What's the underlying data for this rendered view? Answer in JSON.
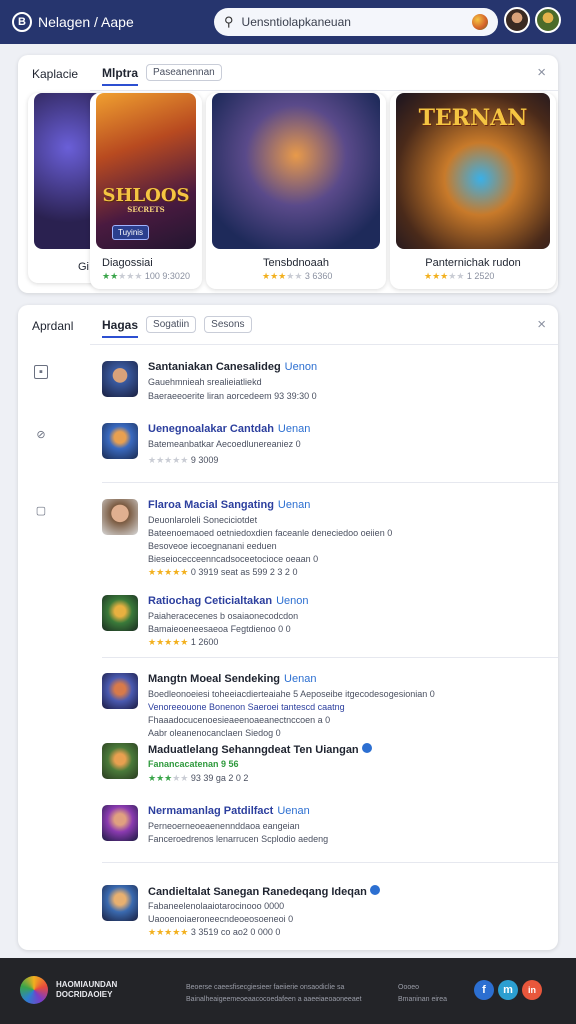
{
  "header": {
    "brand_icon": "B",
    "breadcrumb": "Nelagen / Aape",
    "search_value": "Uensntiolapkaneuan"
  },
  "panel1": {
    "side_title": "Kaplacie",
    "tab": "Mlptra",
    "chip": "Paseanennan",
    "close": "×",
    "cards": [
      {
        "art_title": "SHLOOS",
        "art_sub": "SECRETS",
        "button": "Tuyinis",
        "name": "Diagossiai",
        "partial_left": "Gi",
        "stars": [
          1,
          1,
          0,
          0,
          0
        ],
        "rating_text": "100 9:3020"
      },
      {
        "name": "Tensbdnoaah",
        "stars": [
          1,
          1,
          1,
          0,
          0
        ],
        "rating_text": "3 6360"
      },
      {
        "art_title": "TERNAN",
        "name": "Panternichak rudon",
        "stars": [
          1,
          1,
          1,
          0,
          0
        ],
        "rating_text": "1 2520"
      }
    ]
  },
  "panel2": {
    "side_title": "Aprdanl",
    "tab": "Hagas",
    "chip1": "Sogatiin",
    "chip2": "Sesons",
    "close": "×",
    "rows": [
      {
        "title": "Santaniakan Canesalideg",
        "tag": "Uenon",
        "lines": [
          "Gauehmnieah srealieiatliekd",
          "Baeraeeoerite liran aorcedeem 93 39:30 0"
        ]
      },
      {
        "title": "Uenegnoalakar Cantdah",
        "tag": "Uenan",
        "lines": [
          "Batemeanbatkar Aecoedlunereaniez 0"
        ],
        "rating_text": "9 3009"
      },
      {
        "title": "Flaroa Macial Sangating",
        "tag": "Uenan",
        "lines": [
          "Deuonlaroleli Soneciciotdet",
          "Bateenoemaoed oetniedoxdien faceanle deneciedoo oeiien 0",
          "Besoveoe iecoegnanani eeduen",
          "Bieseiocecceenncadsoceetocioce oeaan 0"
        ],
        "rating_text": "0 3919 seat as 599 2 3 2 0"
      },
      {
        "title": "Ratiochag Ceticialtakan",
        "tag": "Uenon",
        "lines": [
          "Paiaheracecenes b osaiaonecodcdon",
          "Bamaieoeneesaeoa Fegtdienoo 0 0"
        ],
        "rating_text": "1 2600"
      },
      {
        "title": "Mangtn Moeal Sendeking",
        "tag": "Uenan",
        "lines": [
          "Boedleonoeiesi toheeiacdierteaiahe 5 Aeposeibe itgecodesogesionian 0",
          "Venoreeouone Bonenon Saeroei tantescd caatng",
          "Fhaaadocucenoesieaeenoaeanectnccoen a 0",
          "Aabr oleanenocanclaen Siedog 0"
        ]
      },
      {
        "title": "Maduatlelang Sehanngdeat Ten Uiangan",
        "tag": "",
        "lines": [
          "Fanancacatenan 9 56"
        ],
        "green_line": true,
        "rating_text": "93 39 ga 2 0 2"
      },
      {
        "title": "Nermamanlag Patdilfact",
        "tag": "Uenan",
        "lines": [
          "Perneoerneoeaenennddaoa eangeian",
          "Fanceroedrenos lenarrucen Scplodio aedeng"
        ]
      },
      {
        "title": "Candieltalat Sanegan Ranedeqang Ideqan",
        "tag": "",
        "lines": [
          "Fabaneelenolaaiotarocinooo 0000",
          "Uaooenoiaeroneecndeoeosoeneoi 0"
        ],
        "rating_text": "3 3519 co ao2 0 000 0"
      }
    ]
  },
  "footer": {
    "brand": "HAOMIAUNDAN DOCRIDAOIEY",
    "text_a": "Beoerse caeesfisecgiesieer faeiierie onsaodiclie sa",
    "text_b": "Bainalheaigeemeoeaacocoedafeen a aaeeiaeoaoneeaet",
    "text_c": "Oooeo",
    "text_d": "Bmaninan eirea",
    "social": [
      "f",
      "m",
      "in"
    ]
  }
}
